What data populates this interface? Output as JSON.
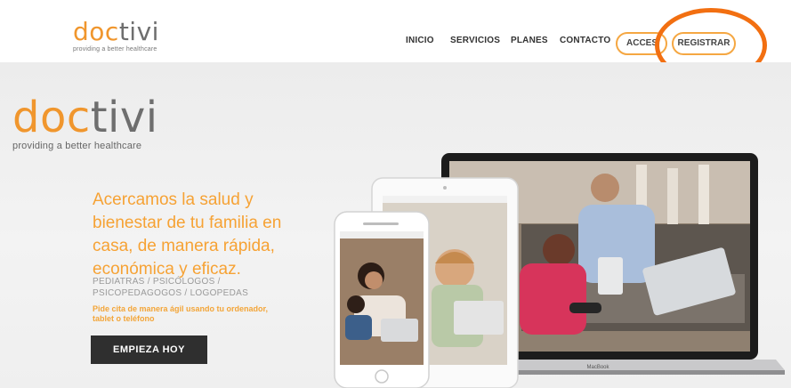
{
  "header": {
    "logo": {
      "doc": "doc",
      "tivi": "tivi",
      "tagline": "providing a better healthcare"
    },
    "nav": [
      "INICIO",
      "SERVICIOS",
      "PLANES",
      "CONTACTO"
    ],
    "access_label": "ACCES",
    "register_label": "REGISTRAR"
  },
  "hero": {
    "logo": {
      "doc": "doc",
      "tivi": "tivi",
      "tagline": "providing a better healthcare"
    },
    "headline": "Acercamos la salud y bienestar de tu familia en casa, de manera rápida, económica y eficaz.",
    "specialties": "PEDIATRAS / PSICÓLOGOS / PSICOPEDAGOGOS / LOGOPEDAS",
    "subcta": "Pide cita de manera ágil usando tu ordenador, tablet o teléfono",
    "cta_label": "EMPIEZA HOY",
    "laptop_brand": "MacBook"
  },
  "colors": {
    "brand_orange": "#f0962d",
    "annotation": "#f26f11",
    "cta_bg": "#2f2f2f"
  }
}
